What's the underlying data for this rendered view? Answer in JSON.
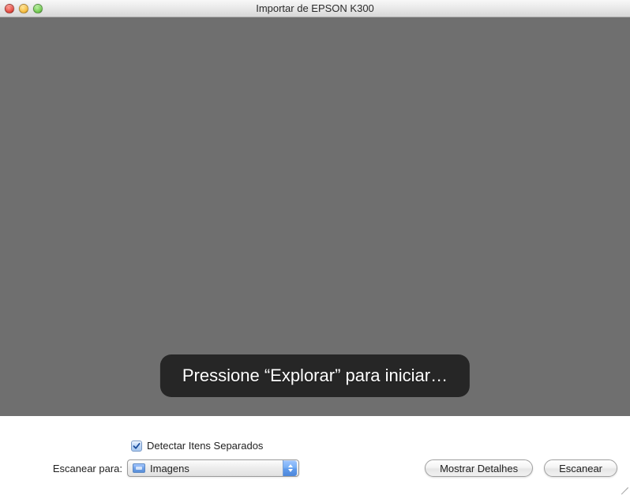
{
  "window": {
    "title": "Importar de EPSON K300"
  },
  "preview": {
    "overlay_message": "Pressione “Explorar” para iniciar…"
  },
  "controls": {
    "detect_checkbox_label": "Detectar Itens Separados",
    "detect_checked": true,
    "scan_to_label": "Escanear para:",
    "scan_to_value": "Imagens",
    "show_details_label": "Mostrar Detalhes",
    "scan_button_label": "Escanear"
  }
}
